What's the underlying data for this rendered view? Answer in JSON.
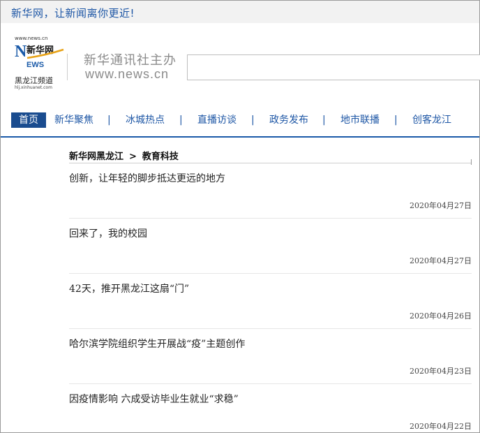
{
  "topbar": {
    "slogan": "新华网，让新闻离你更近!"
  },
  "header": {
    "logo_url": "www.news.cn",
    "logo_text": "新华网",
    "logo_news": "NEWS",
    "logo_channel": "黑龙江频道",
    "logo_channel_url": "hlj.xinhuanet.com",
    "org": "新华通讯社主办",
    "site": "www.news.cn"
  },
  "nav": {
    "items": [
      {
        "label": "首页",
        "active": true
      },
      {
        "label": "新华聚焦"
      },
      {
        "label": "冰城热点"
      },
      {
        "label": "直播访谈"
      },
      {
        "label": "政务发布"
      },
      {
        "label": "地市联播"
      },
      {
        "label": "创客龙江"
      }
    ],
    "separator": "|"
  },
  "breadcrumb": {
    "home": "新华网黑龙江",
    "arrow": ">",
    "section": "教育科技"
  },
  "articles": [
    {
      "title": "创新，让年轻的脚步抵达更远的地方",
      "date": "2020年04月27日"
    },
    {
      "title": "回来了，我的校园",
      "date": "2020年04月27日"
    },
    {
      "title": "42天，推开黑龙江这扇“门”",
      "date": "2020年04月26日"
    },
    {
      "title": "哈尔滨学院组织学生开展战“疫”主题创作",
      "date": "2020年04月23日"
    },
    {
      "title": "因疫情影响 六成受访毕业生就业“求稳”",
      "date": "2020年04月22日"
    }
  ],
  "colors": {
    "brand": "#1d56a5",
    "nav_active": "#1a4c8f"
  }
}
